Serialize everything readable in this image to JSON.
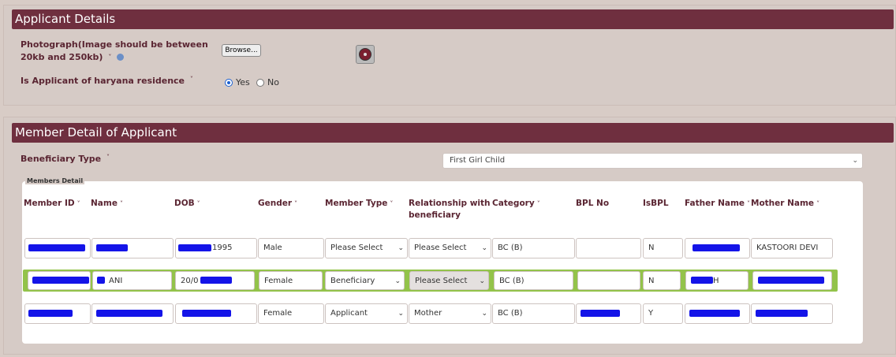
{
  "applicant": {
    "title": "Applicant Details",
    "photo_label": "Photograph(Image should be between 20kb and 250kb)",
    "browse_label": "Browse...",
    "residence_label": "Is Applicant of haryana residence",
    "residence_yes": "Yes",
    "residence_no": "No",
    "residence_selected": "Yes"
  },
  "members": {
    "title": "Member Detail of Applicant",
    "beneficiary_type_label": "Beneficiary Type",
    "beneficiary_type_value": "First Girl Child",
    "legend": "Members Detail",
    "columns": [
      "Member ID",
      "Name",
      "DOB",
      "Gender",
      "Member Type",
      "Relationship with beneficiary",
      "Category",
      "BPL No",
      "IsBPL",
      "Father Name",
      "Mother Name"
    ],
    "rows": [
      {
        "member_id": "",
        "name": "",
        "dob": "1995",
        "gender": "Male",
        "member_type": "Please Select",
        "relationship": "Please Select",
        "category": "BC (B)",
        "bpl_no": "",
        "isbpl": "N",
        "father_name": "",
        "mother_name": "KASTOORI DEVI"
      },
      {
        "member_id": "",
        "name": "ANI",
        "dob": "20/0",
        "gender": "Female",
        "member_type": "Beneficiary",
        "relationship": "Please Select",
        "category": "BC (B)",
        "bpl_no": "",
        "isbpl": "N",
        "father_name": "H",
        "mother_name": ""
      },
      {
        "member_id": "",
        "name": "",
        "dob": "",
        "gender": "Female",
        "member_type": "Applicant",
        "relationship": "Mother",
        "category": "BC (B)",
        "bpl_no": "",
        "isbpl": "Y",
        "father_name": "",
        "mother_name": ""
      }
    ]
  },
  "colors": {
    "header_bg": "#6f2f3f",
    "label": "#5a2532",
    "highlight_row": "#93c34a",
    "redaction": "#1414e8"
  }
}
